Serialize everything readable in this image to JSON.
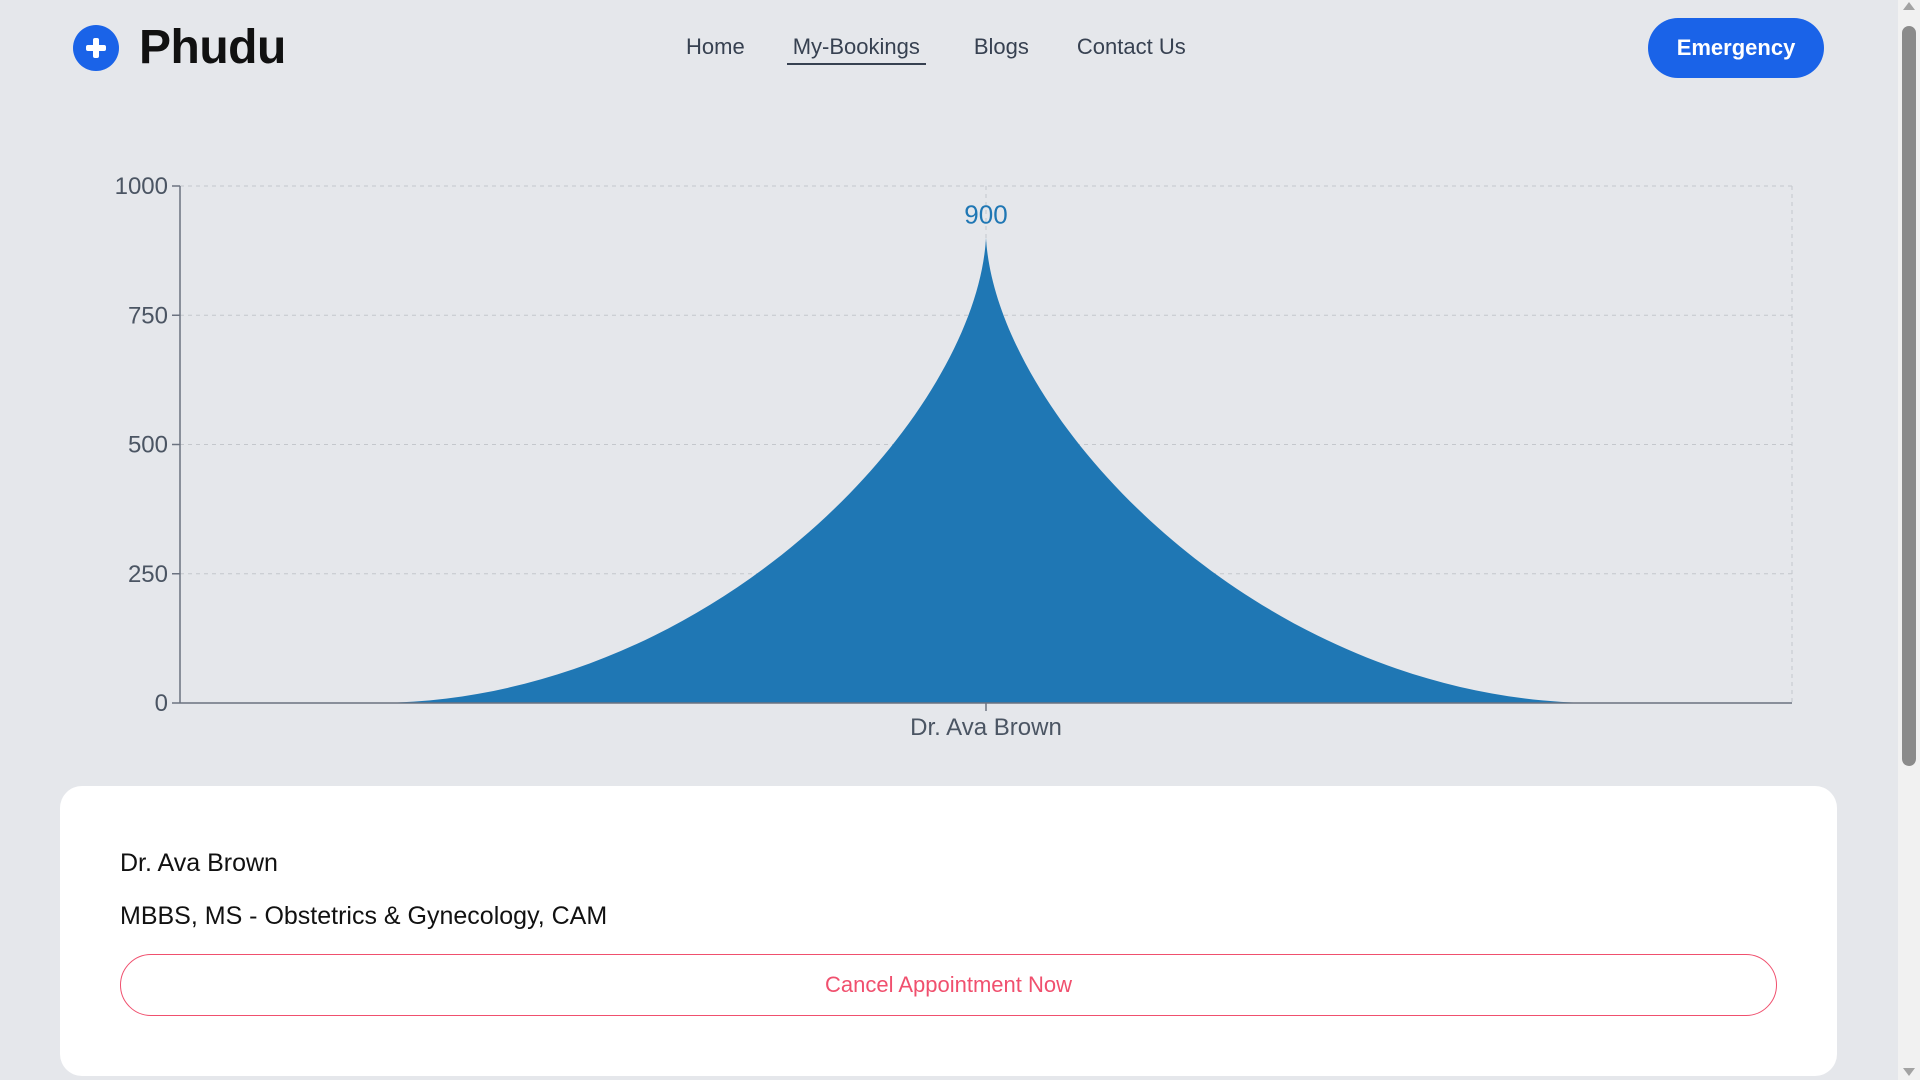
{
  "brand": {
    "name": "Phudu",
    "icon": "plus-circle-icon"
  },
  "nav": {
    "items": [
      {
        "label": "Home"
      },
      {
        "label": "My-Bookings"
      },
      {
        "label": "Blogs"
      },
      {
        "label": "Contact Us"
      }
    ],
    "active": "My-Bookings",
    "emergency_label": "Emergency"
  },
  "colors": {
    "primary": "#1a63e8",
    "series": "#1f77b4",
    "cancel": "#f0506e",
    "background": "#e5e7eb"
  },
  "chart_data": {
    "type": "area",
    "categories": [
      "Dr. Ava Brown"
    ],
    "values": [
      900
    ],
    "ylim": [
      0,
      1000
    ],
    "yticks": [
      0,
      250,
      500,
      750,
      1000
    ],
    "grid": true,
    "data_labels": [
      "900"
    ]
  },
  "booking": {
    "doctor_name": "Dr. Ava Brown",
    "qualification": "MBBS, MS - Obstetrics & Gynecology, CAM",
    "cancel_label": "Cancel Appointment Now"
  }
}
